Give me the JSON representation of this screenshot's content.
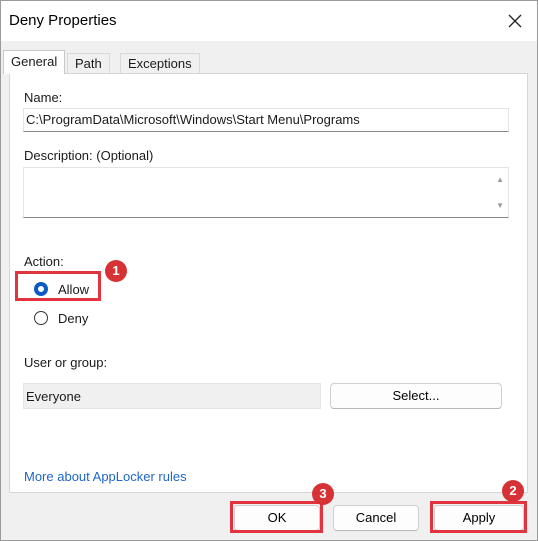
{
  "window": {
    "title": "Deny Properties"
  },
  "tabs": [
    {
      "label": "General",
      "active": true
    },
    {
      "label": "Path",
      "active": false
    },
    {
      "label": "Exceptions",
      "active": false
    }
  ],
  "fields": {
    "name_label": "Name:",
    "name_value": "C:\\ProgramData\\Microsoft\\Windows\\Start Menu\\Programs",
    "description_label": "Description: (Optional)",
    "description_value": ""
  },
  "action": {
    "label": "Action:",
    "options": [
      {
        "label": "Allow",
        "selected": true
      },
      {
        "label": "Deny",
        "selected": false
      }
    ]
  },
  "user_group": {
    "label": "User or group:",
    "value": "Everyone",
    "select_button": "Select..."
  },
  "link_text": "More about AppLocker rules",
  "buttons": {
    "ok": "OK",
    "cancel": "Cancel",
    "apply": "Apply"
  },
  "annotations": {
    "highlight_color": "#e2343f",
    "badge_color": "#d63235",
    "badges": [
      "1",
      "2",
      "3"
    ]
  },
  "colors": {
    "accent": "#0a5bc4",
    "link": "#1e66c8"
  }
}
